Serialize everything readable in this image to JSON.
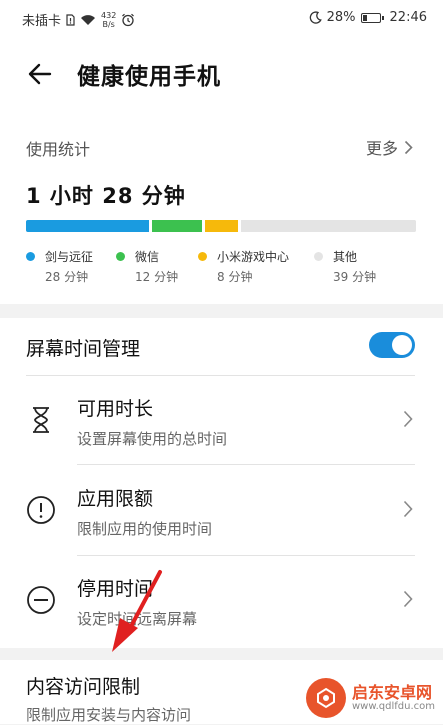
{
  "status_bar": {
    "carrier": "未插卡",
    "net_speed_value": "432",
    "net_speed_unit": "B/s",
    "battery": "28%",
    "battery_level": 0.28,
    "time": "22:46"
  },
  "header": {
    "title": "健康使用手机"
  },
  "usage": {
    "label": "使用统计",
    "more": "更多",
    "total": "1 小时 28 分钟",
    "apps": [
      {
        "name": "剑与远征",
        "time": "28 分钟",
        "minutes": 28,
        "color": "#1a9be0"
      },
      {
        "name": "微信",
        "time": "12 分钟",
        "minutes": 12,
        "color": "#3cc14f"
      },
      {
        "name": "小米游戏中心",
        "time": "8 分钟",
        "minutes": 8,
        "color": "#f6b90b"
      },
      {
        "name": "其他",
        "time": "39 分钟",
        "minutes": 39,
        "color": "#e4e4e4"
      }
    ]
  },
  "screen_time": {
    "title": "屏幕时间管理",
    "enabled": true,
    "rows": [
      {
        "title": "可用时长",
        "subtitle": "设置屏幕使用的总时间",
        "icon": "hourglass-icon"
      },
      {
        "title": "应用限额",
        "subtitle": "限制应用的使用时间",
        "icon": "alert-circle-icon"
      },
      {
        "title": "停用时间",
        "subtitle": "设定时间远离屏幕",
        "icon": "minus-circle-icon"
      }
    ]
  },
  "content_restriction": {
    "title": "内容访问限制",
    "subtitle": "限制应用安装与内容访问"
  },
  "watermark": {
    "name": "启东安卓网",
    "url": "www.qdlfdu.com"
  },
  "colors": {
    "accent": "#1a8ddb",
    "arrow": "#e02020",
    "watermark": "#e8542b"
  }
}
